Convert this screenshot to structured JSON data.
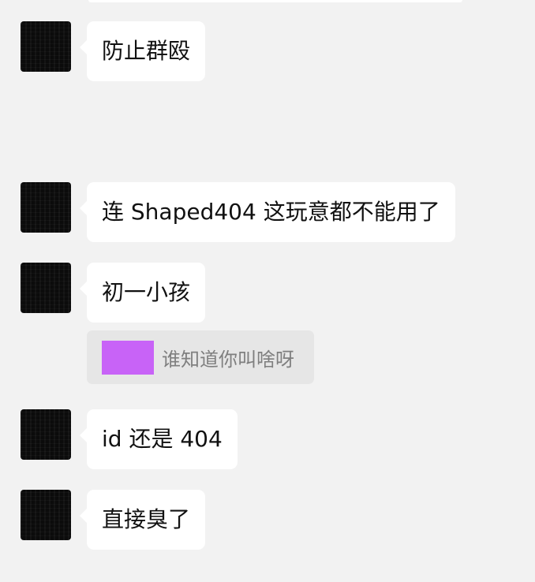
{
  "colors": {
    "background": "#f2f2f2",
    "bubble": "#ffffff",
    "quote_background": "#e6e6e6",
    "quote_thumbnail": "#c863f7",
    "avatar": "#0b0b0b"
  },
  "messages": [
    {
      "text": "防止群殴"
    },
    {
      "text": "连 Shaped404 这玩意都不能用了"
    },
    {
      "text": "初一小孩"
    },
    {
      "text": "id 还是 404"
    },
    {
      "text": "直接臭了"
    }
  ],
  "quote": {
    "text": "谁知道你叫啥呀",
    "thumbnail_icon": "image-thumbnail-icon"
  }
}
